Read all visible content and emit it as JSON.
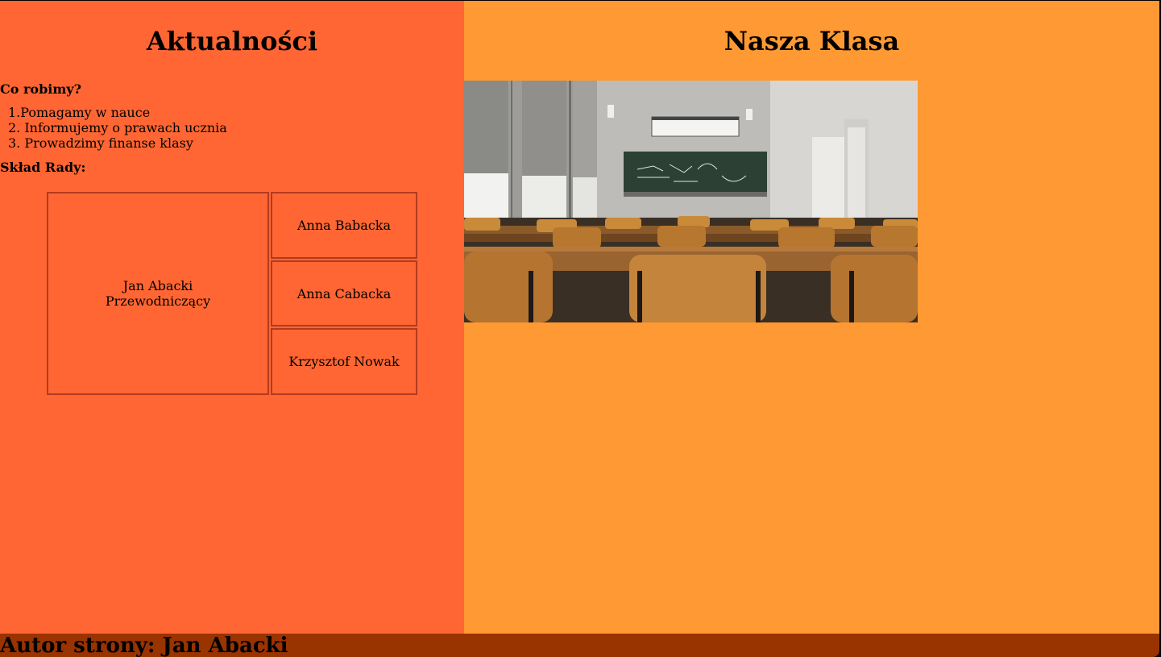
{
  "left": {
    "title": "Aktualności",
    "subtitle": "Co robimy?",
    "items": [
      "1.Pomagamy w nauce",
      "2. Informujemy o prawach ucznia",
      "3. Prowadzimy finanse klasy"
    ],
    "council_title": "Skład Rady:",
    "chair_name": "Jan Abacki",
    "chair_role": "Przewodniczący",
    "members": [
      "Anna Babacka",
      "Anna Cabacka",
      "Krzysztof Nowak"
    ]
  },
  "right": {
    "title": "Nasza Klasa",
    "image_icon": "classroom-photo"
  },
  "footer": {
    "text": "Autor strony: Jan Abacki"
  },
  "colors": {
    "left_bg": "#ff6633",
    "right_bg": "#ff9933",
    "footer_bg": "#993300"
  }
}
